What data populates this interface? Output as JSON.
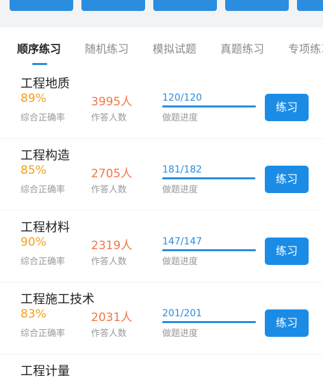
{
  "tabs": [
    "顺序练习",
    "随机练习",
    "模拟试题",
    "真题练习",
    "专项练习"
  ],
  "accent": "#2b8de0",
  "subjects": [
    {
      "title": "工程地质",
      "accuracy": "89%",
      "accuracy_label": "综合正确率",
      "answers": "3995人",
      "answers_label": "作答人数",
      "progress": "120/120",
      "progress_fraction": 1.0,
      "progress_label": "做题进度",
      "button": "练习"
    },
    {
      "title": "工程构造",
      "accuracy": "85%",
      "accuracy_label": "综合正确率",
      "answers": "2705人",
      "answers_label": "作答人数",
      "progress": "181/182",
      "progress_fraction": 0.995,
      "progress_label": "做题进度",
      "button": "练习"
    },
    {
      "title": "工程材料",
      "accuracy": "90%",
      "accuracy_label": "综合正确率",
      "answers": "2319人",
      "answers_label": "作答人数",
      "progress": "147/147",
      "progress_fraction": 1.0,
      "progress_label": "做题进度",
      "button": "练习"
    },
    {
      "title": "工程施工技术",
      "accuracy": "83%",
      "accuracy_label": "综合正确率",
      "answers": "2031人",
      "answers_label": "作答人数",
      "progress": "201/201",
      "progress_fraction": 1.0,
      "progress_label": "做题进度",
      "button": "练习"
    },
    {
      "title": "工程计量",
      "accuracy": "",
      "accuracy_label": "",
      "answers": "",
      "answers_label": "",
      "progress": "",
      "progress_fraction": 0,
      "progress_label": "",
      "button": ""
    }
  ]
}
